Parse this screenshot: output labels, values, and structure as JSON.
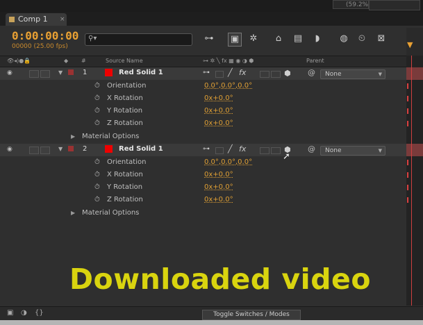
{
  "topbar": {
    "readout": "(59.2%)"
  },
  "tab": {
    "label": "Comp 1",
    "close": "×"
  },
  "timecode": "0:00:00:00",
  "fps": "00000 (25.00 fps)",
  "search": {
    "icon": "search-icon",
    "value": ""
  },
  "columns": {
    "source_name": "Source Name",
    "parent": "Parent",
    "hash": "#"
  },
  "layers": [
    {
      "number": "1",
      "name": "Red Solid 1",
      "parent": "None",
      "props": [
        {
          "name": "Orientation",
          "value": "0.0°,0.0°,0.0°"
        },
        {
          "name": "X Rotation",
          "value": "0x+0.0°"
        },
        {
          "name": "Y Rotation",
          "value": "0x+0.0°"
        },
        {
          "name": "Z Rotation",
          "value": "0x+0.0°"
        }
      ],
      "material": "Material Options"
    },
    {
      "number": "2",
      "name": "Red Solid 1",
      "parent": "None",
      "props": [
        {
          "name": "Orientation",
          "value": "0.0°,0.0°,0.0°"
        },
        {
          "name": "X Rotation",
          "value": "0x+0.0°"
        },
        {
          "name": "Y Rotation",
          "value": "0x+0.0°"
        },
        {
          "name": "Z Rotation",
          "value": "0x+0.0°"
        }
      ],
      "material": "Material Options"
    }
  ],
  "watermark": "Downloaded video",
  "bottom": {
    "toggle_label": "Toggle Switches / Modes"
  },
  "colors": {
    "accent": "#e8a033",
    "layer_label": "#9a3232",
    "solid": "#ee0000",
    "watermark": "#d9d40f"
  }
}
